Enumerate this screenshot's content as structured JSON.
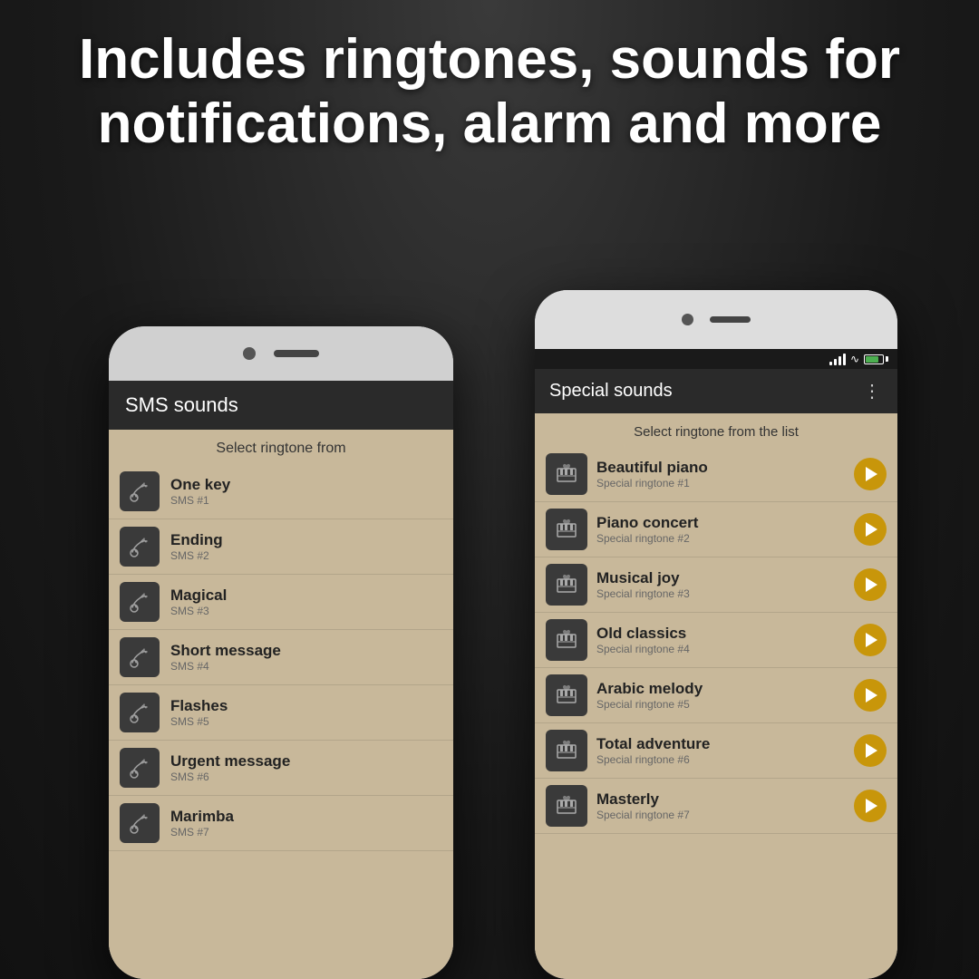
{
  "header": {
    "line1": "Includes ringtones, sounds for",
    "line2": "notifications, alarm and more"
  },
  "phone_back": {
    "title": "SMS sounds",
    "subtitle": "Select ringtone from",
    "items": [
      {
        "name": "One key",
        "sub": "SMS #1"
      },
      {
        "name": "Ending",
        "sub": "SMS #2"
      },
      {
        "name": "Magical",
        "sub": "SMS #3"
      },
      {
        "name": "Short message",
        "sub": "SMS #4"
      },
      {
        "name": "Flashes",
        "sub": "SMS #5"
      },
      {
        "name": "Urgent message",
        "sub": "SMS #6"
      },
      {
        "name": "Marimba",
        "sub": "SMS #7"
      }
    ]
  },
  "phone_front": {
    "title": "Special sounds",
    "subtitle": "Select ringtone from the list",
    "items": [
      {
        "name": "Beautiful piano",
        "sub": "Special ringtone #1"
      },
      {
        "name": "Piano concert",
        "sub": "Special ringtone #2"
      },
      {
        "name": "Musical joy",
        "sub": "Special ringtone #3"
      },
      {
        "name": "Old classics",
        "sub": "Special ringtone #4"
      },
      {
        "name": "Arabic melody",
        "sub": "Special ringtone #5"
      },
      {
        "name": "Total adventure",
        "sub": "Special ringtone #6"
      },
      {
        "name": "Masterly",
        "sub": "Special ringtone #7"
      }
    ],
    "menu_icon": "⋮"
  }
}
